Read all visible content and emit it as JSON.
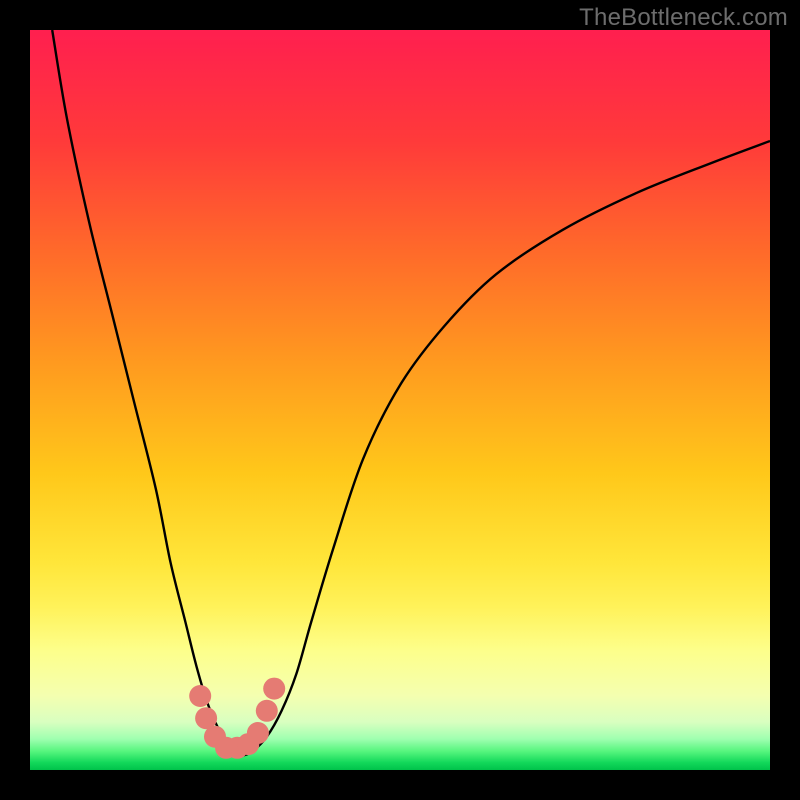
{
  "watermark": "TheBottleneck.com",
  "chart_data": {
    "type": "line",
    "title": "",
    "xlabel": "",
    "ylabel": "",
    "xlim": [
      0,
      100
    ],
    "ylim": [
      0,
      100
    ],
    "grid": false,
    "legend": false,
    "series": [
      {
        "name": "bottleneck-curve",
        "color": "#000000",
        "x": [
          3,
          5,
          8,
          11,
          14,
          17,
          19,
          21,
          22.5,
          24,
          25.5,
          27,
          28.5,
          30,
          32,
          34,
          36,
          38,
          41,
          45,
          50,
          56,
          63,
          72,
          82,
          92,
          100
        ],
        "y": [
          100,
          88,
          74,
          62,
          50,
          38,
          28,
          20,
          14,
          9,
          5.5,
          3,
          2,
          2.5,
          4.5,
          8,
          13,
          20,
          30,
          42,
          52,
          60,
          67,
          73,
          78,
          82,
          85
        ]
      }
    ],
    "markers": {
      "name": "highlight-points",
      "color": "#e57b73",
      "points": [
        {
          "x": 23.0,
          "y": 10.0
        },
        {
          "x": 23.8,
          "y": 7.0
        },
        {
          "x": 25.0,
          "y": 4.5
        },
        {
          "x": 26.5,
          "y": 3.0
        },
        {
          "x": 28.0,
          "y": 3.0
        },
        {
          "x": 29.5,
          "y": 3.5
        },
        {
          "x": 30.8,
          "y": 5.0
        },
        {
          "x": 32.0,
          "y": 8.0
        },
        {
          "x": 33.0,
          "y": 11.0
        }
      ]
    },
    "background_gradient": {
      "stops": [
        {
          "offset": 0.0,
          "color": "#ff1f4f"
        },
        {
          "offset": 0.15,
          "color": "#ff3a3a"
        },
        {
          "offset": 0.3,
          "color": "#ff6a2a"
        },
        {
          "offset": 0.45,
          "color": "#ff9a1f"
        },
        {
          "offset": 0.6,
          "color": "#ffc81a"
        },
        {
          "offset": 0.72,
          "color": "#ffe63a"
        },
        {
          "offset": 0.78,
          "color": "#fff25a"
        },
        {
          "offset": 0.84,
          "color": "#fdff8c"
        },
        {
          "offset": 0.9,
          "color": "#f4ffb0"
        },
        {
          "offset": 0.935,
          "color": "#d9ffc0"
        },
        {
          "offset": 0.958,
          "color": "#9fffb0"
        },
        {
          "offset": 0.975,
          "color": "#55f57d"
        },
        {
          "offset": 0.99,
          "color": "#12d85a"
        },
        {
          "offset": 1.0,
          "color": "#00c24a"
        }
      ]
    }
  }
}
